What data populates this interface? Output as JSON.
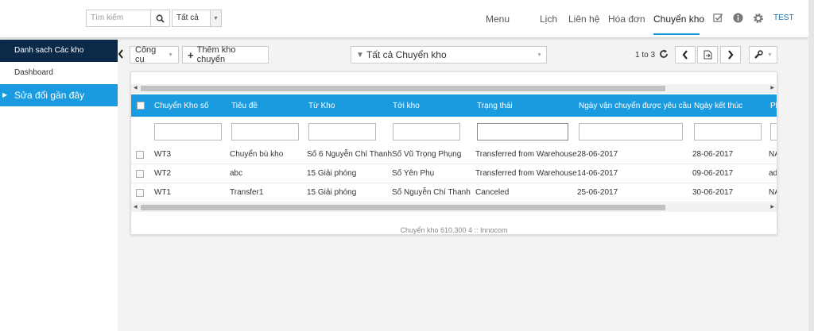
{
  "topbar": {
    "search_placeholder": "Tìm kiếm",
    "filter_value": "Tất cả",
    "nav": [
      "Menu",
      "Lịch",
      "Liên hệ",
      "Hóa đơn",
      "Chuyển kho"
    ],
    "user": "TEST"
  },
  "sidebar": {
    "items": [
      {
        "label": "Danh sach Các kho chuyển"
      },
      {
        "label": "Dashboard"
      },
      {
        "label": "Sửa đổi gần đây"
      }
    ]
  },
  "toolbar": {
    "tools_label": "Công cụ",
    "add_label": "Thêm kho chuyển",
    "view_filter": "Tất cả Chuyển kho",
    "pager_text": "1 to 3"
  },
  "table": {
    "columns": [
      "Chuyển Kho số",
      "Tiêu đề",
      "Từ Kho",
      "Tới kho",
      "Trạng thái",
      "Ngày vận chuyển được yêu cầu",
      "Ngày kết thúc",
      "Ph"
    ],
    "rows": [
      [
        "WT3",
        "Chuyển bù kho",
        "Số 6 Nguyễn Chí Thanh",
        "Số  Vũ Trọng Phụng",
        "Transferred from Warehouse",
        "28-06-2017",
        "28-06-2017",
        "NA"
      ],
      [
        "WT2",
        "abc",
        "15 Giải phóng",
        "Số  Yên Phụ",
        "Transferred from Warehouse",
        "14-06-2017",
        "09-06-2017",
        "ad"
      ],
      [
        "WT1",
        "Transfer1",
        "15 Giải phóng",
        "Số  Nguyễn Chí Thanh",
        "Canceled",
        "25-06-2017",
        "30-06-2017",
        "NA"
      ]
    ],
    "footer": "Chuyển kho 610.300 4 :: Innocom"
  },
  "colors": {
    "accent": "#1a9be0",
    "sidebar_dark": "#0b2a49"
  }
}
